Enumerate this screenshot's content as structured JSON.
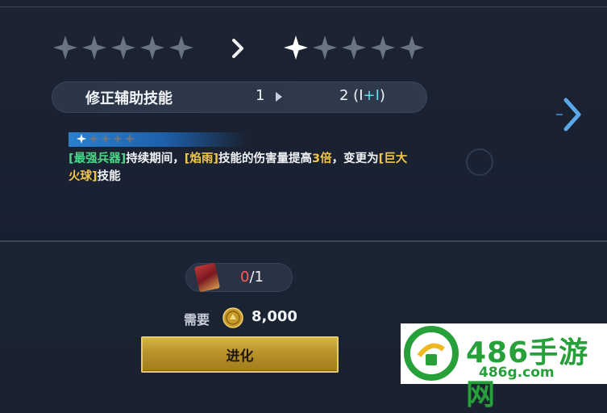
{
  "evolution": {
    "stars_before": 0,
    "stars_after": 1,
    "stars_total": 5
  },
  "skill": {
    "name": "修正辅助技能",
    "level_from": "1",
    "level_to": "2",
    "level_bonus_prefix": " (I",
    "level_bonus": "+I",
    "level_bonus_suffix": ")"
  },
  "description": {
    "banner_stars_filled": 1,
    "banner_stars_total": 5,
    "tag1": "[最强兵器]",
    "text1": "持续期间，",
    "tag2": "[焰雨]",
    "text2": "技能的伤害量提高",
    "highlight": "3倍",
    "text3": "，变更为",
    "tag3": "[巨大火球]",
    "text4": "技能"
  },
  "material": {
    "have": "0",
    "need": "/1"
  },
  "cost": {
    "label": "需要",
    "value": "8,000"
  },
  "button": {
    "evolve_label": "进化"
  },
  "watermark": {
    "title": "486手游网",
    "url": "486g.com"
  },
  "colors": {
    "star_empty": "#6b7482",
    "star_filled": "#ffffff",
    "tag_green": "#4fd48a",
    "tag_yellow": "#f2c64a",
    "bonus_cyan": "#5fe0e8",
    "material_have_red": "#ff5a5a",
    "button_gold": "#c8a43a",
    "watermark_green": "#27a03a"
  }
}
